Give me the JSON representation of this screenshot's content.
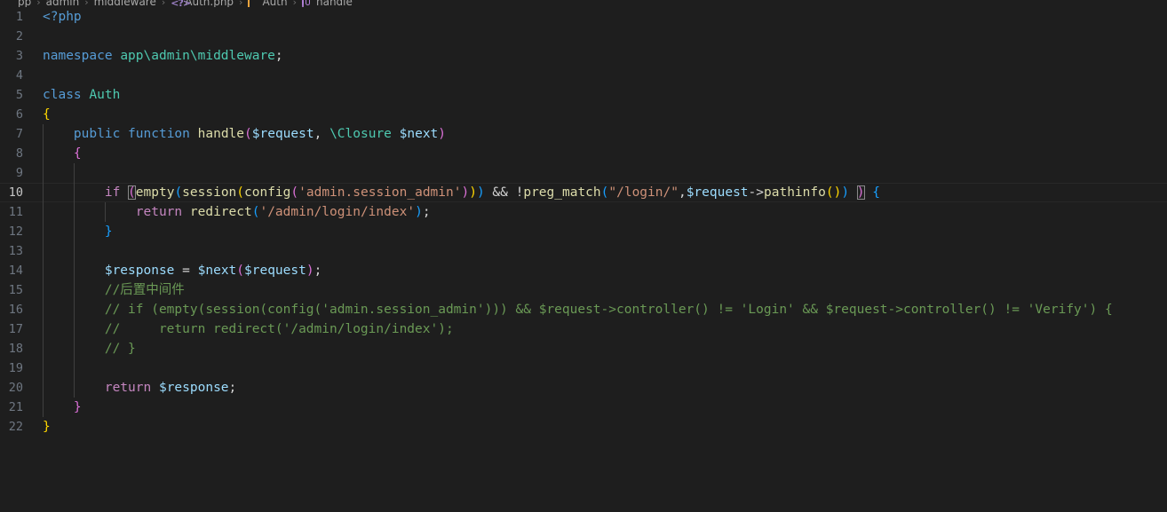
{
  "breadcrumb": {
    "items": [
      {
        "label": "pp",
        "icon": ""
      },
      {
        "label": "admin",
        "icon": ""
      },
      {
        "label": "middleware",
        "icon": ""
      },
      {
        "label": "Auth.php",
        "icon": "php-file-icon"
      },
      {
        "label": "Auth",
        "icon": "class-icon"
      },
      {
        "label": "handle",
        "icon": "method-icon"
      }
    ],
    "separator": "›"
  },
  "editor": {
    "language": "php",
    "active_line": 10,
    "theme_background": "#1e1e1e",
    "colors": {
      "keyword": "#569CD6",
      "control": "#C586C0",
      "type": "#4EC9B0",
      "function": "#DCDCAA",
      "variable": "#9CDCFE",
      "string": "#CE9178",
      "comment": "#6A9955",
      "plain": "#d4d4d4",
      "line_number": "#6e7681",
      "line_number_active": "#c6c6c6",
      "indent_guide": "#404040"
    },
    "lines": [
      {
        "n": "1",
        "indent": 0,
        "text": "<?php"
      },
      {
        "n": "2",
        "indent": 0,
        "text": ""
      },
      {
        "n": "3",
        "indent": 0,
        "text": "namespace app\\admin\\middleware;"
      },
      {
        "n": "4",
        "indent": 0,
        "text": ""
      },
      {
        "n": "5",
        "indent": 0,
        "text": "class Auth"
      },
      {
        "n": "6",
        "indent": 0,
        "text": "{"
      },
      {
        "n": "7",
        "indent": 1,
        "text": "    public function handle($request, \\Closure $next)"
      },
      {
        "n": "8",
        "indent": 1,
        "text": "    {"
      },
      {
        "n": "9",
        "indent": 2,
        "text": ""
      },
      {
        "n": "10",
        "indent": 2,
        "text": "        if (empty(session(config('admin.session_admin'))) && !preg_match(\"/login/\",$request->pathinfo()) ) {"
      },
      {
        "n": "11",
        "indent": 3,
        "text": "            return redirect('/admin/login/index');"
      },
      {
        "n": "12",
        "indent": 2,
        "text": "        }"
      },
      {
        "n": "13",
        "indent": 2,
        "text": ""
      },
      {
        "n": "14",
        "indent": 2,
        "text": "        $response = $next($request);"
      },
      {
        "n": "15",
        "indent": 2,
        "text": "        //后置中间件"
      },
      {
        "n": "16",
        "indent": 2,
        "text": "        // if (empty(session(config('admin.session_admin'))) && $request->controller() != 'Login' && $request->controller() != 'Verify') {"
      },
      {
        "n": "17",
        "indent": 2,
        "text": "        //     return redirect('/admin/login/index');"
      },
      {
        "n": "18",
        "indent": 2,
        "text": "        // }"
      },
      {
        "n": "19",
        "indent": 2,
        "text": ""
      },
      {
        "n": "20",
        "indent": 2,
        "text": "        return $response;"
      },
      {
        "n": "21",
        "indent": 1,
        "text": "    }"
      },
      {
        "n": "22",
        "indent": 0,
        "text": "}"
      }
    ]
  }
}
